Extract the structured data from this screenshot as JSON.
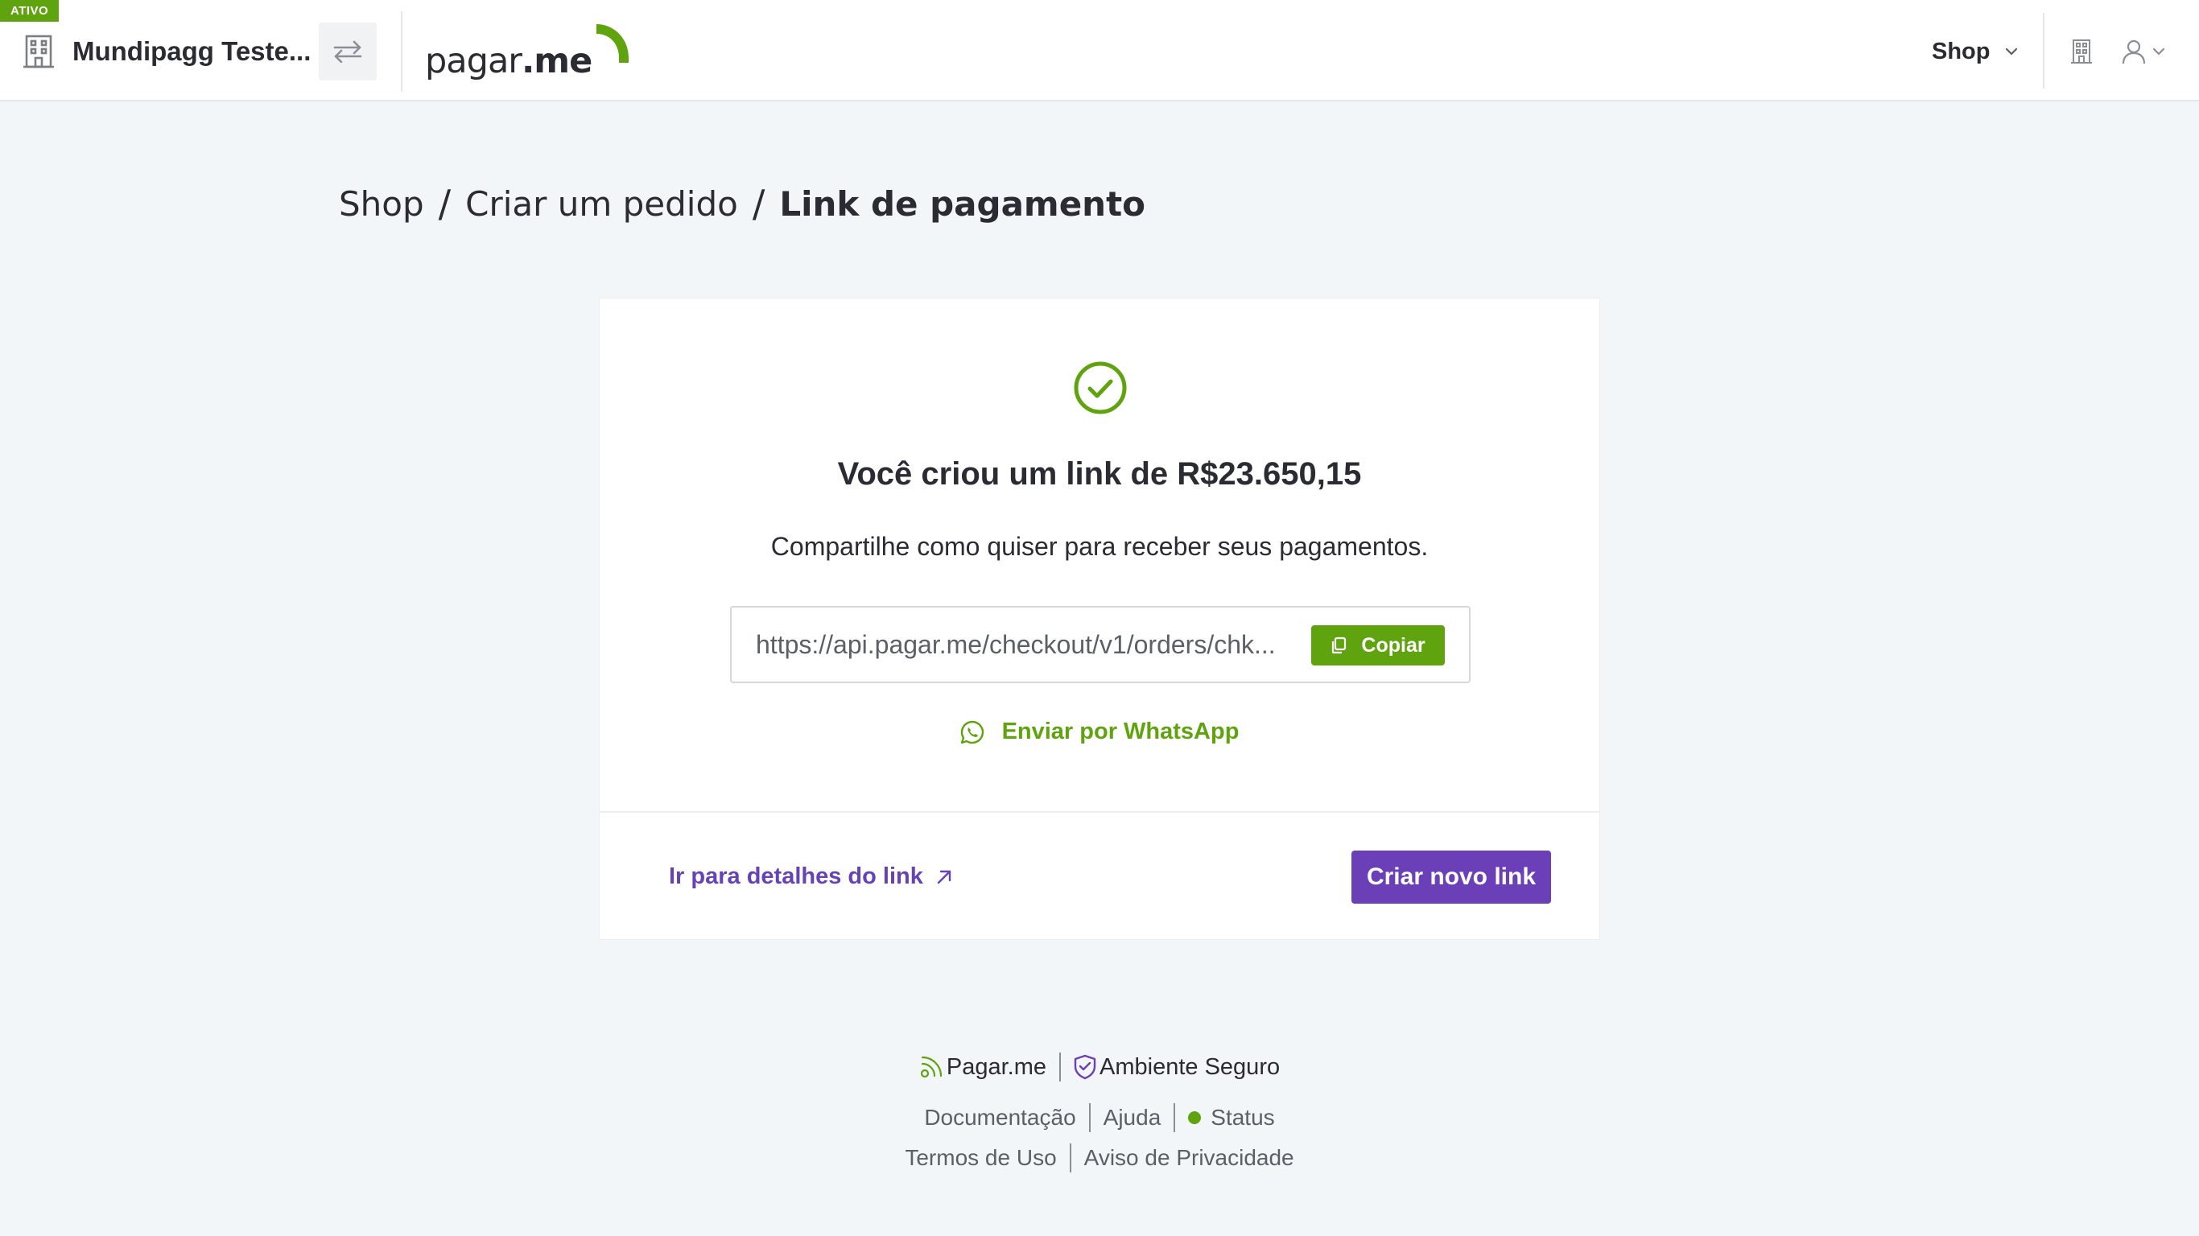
{
  "header": {
    "status_badge": "ATIVO",
    "company_name": "Mundipagg Teste...",
    "logo": {
      "text_main": "pagar",
      "text_suffix": ".me"
    },
    "shop_menu_label": "Shop"
  },
  "breadcrumb": {
    "items": [
      "Shop",
      "Criar um pedido"
    ],
    "separator": "/",
    "current": "Link de pagamento"
  },
  "card": {
    "title": "Você criou um link de R$23.650,15",
    "subtitle": "Compartilhe como quiser para receber seus pagamentos.",
    "link_value": "https://api.pagar.me/checkout/v1/orders/chk...",
    "copy_label": "Copiar",
    "whatsapp_label": "Enviar por WhatsApp",
    "details_label": "Ir para detalhes do link",
    "new_link_label": "Criar novo link"
  },
  "footer": {
    "brand": "Pagar.me",
    "secure": "Ambiente Seguro",
    "links": [
      "Documentação",
      "Ajuda",
      "Status"
    ],
    "legal": [
      "Termos de Uso",
      "Aviso de Privacidade"
    ]
  },
  "colors": {
    "accent_green": "#5fa30f",
    "accent_purple": "#6a3fb8",
    "text_dark": "#2b2b33",
    "background": "#f3f6f8"
  },
  "icons": {
    "company": "building-icon",
    "switch": "swap-arrows-icon",
    "shop_menu": "chevron-down-icon",
    "header_building": "building-icon",
    "user": "user-icon",
    "success": "check-circle-icon",
    "copy": "copy-icon",
    "whatsapp": "whatsapp-icon",
    "details": "arrow-up-right-icon",
    "footer_brand": "pagarme-icon",
    "footer_secure": "shield-check-icon"
  }
}
